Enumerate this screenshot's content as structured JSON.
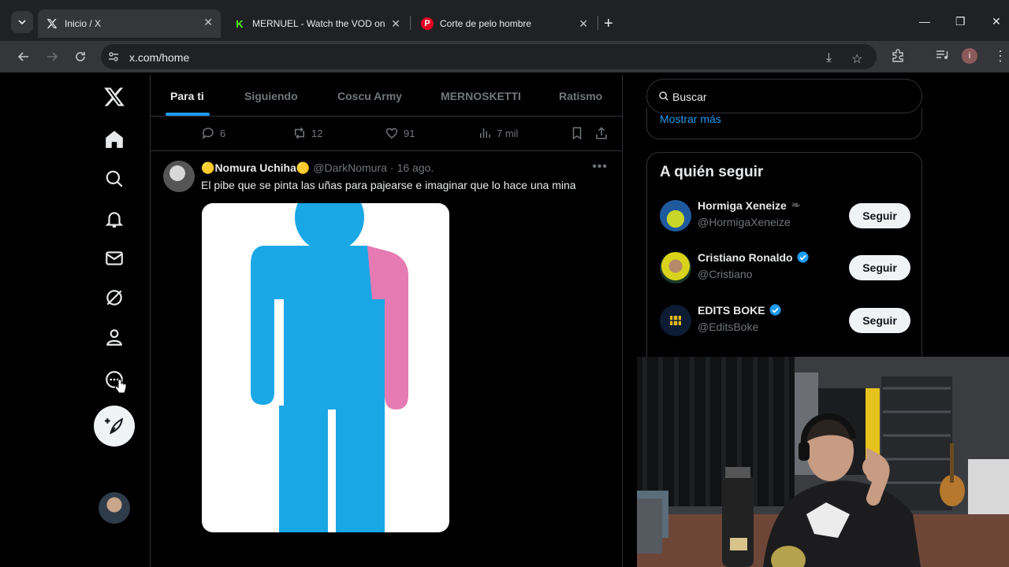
{
  "browser": {
    "tabs": [
      {
        "title": "Inicio / X",
        "active": true,
        "favicon": "x-logo-icon"
      },
      {
        "title": "MERNUEL - Watch the VOD on",
        "active": false,
        "favicon": "kick-logo-icon",
        "fav_color": "#53fc18"
      },
      {
        "title": "Corte de pelo hombre",
        "active": false,
        "favicon": "pinterest-logo-icon",
        "fav_color": "#e60023"
      }
    ],
    "url": "x.com/home",
    "profile_initial": "i"
  },
  "x": {
    "feed_tabs": [
      "Para ti",
      "Siguiendo",
      "Coscu Army",
      "MERNOSKETTI",
      "Ratismo"
    ],
    "prev_tweet_actions": {
      "replies": "6",
      "reposts": "12",
      "likes": "91",
      "views": "7 mil"
    },
    "tweet": {
      "name_prefix": "🟡",
      "name": "Nomura Uchiha",
      "name_suffix": "🟡",
      "handle": "@DarkNomura",
      "sep": "·",
      "date": "16 ago.",
      "text": "El pibe que se pinta las uñas para pajearse e imaginar que lo hace una mina"
    },
    "sidebar": {
      "search_placeholder": "Buscar",
      "show_more": "Mostrar más",
      "who_to_follow_title": "A quién seguir",
      "suggestions": [
        {
          "name": "Hormiga Xeneize",
          "handle": "@HormigaXeneize",
          "verified": false,
          "button": "Seguir"
        },
        {
          "name": "Cristiano Ronaldo",
          "handle": "@Cristiano",
          "verified": true,
          "button": "Seguir"
        },
        {
          "name": "EDITS BOKE",
          "handle": "@EditsBoke",
          "verified": true,
          "button": "Seguir"
        }
      ]
    },
    "colors": {
      "accent": "#1d9bf0",
      "background": "#000000",
      "border": "#2f3336"
    }
  }
}
